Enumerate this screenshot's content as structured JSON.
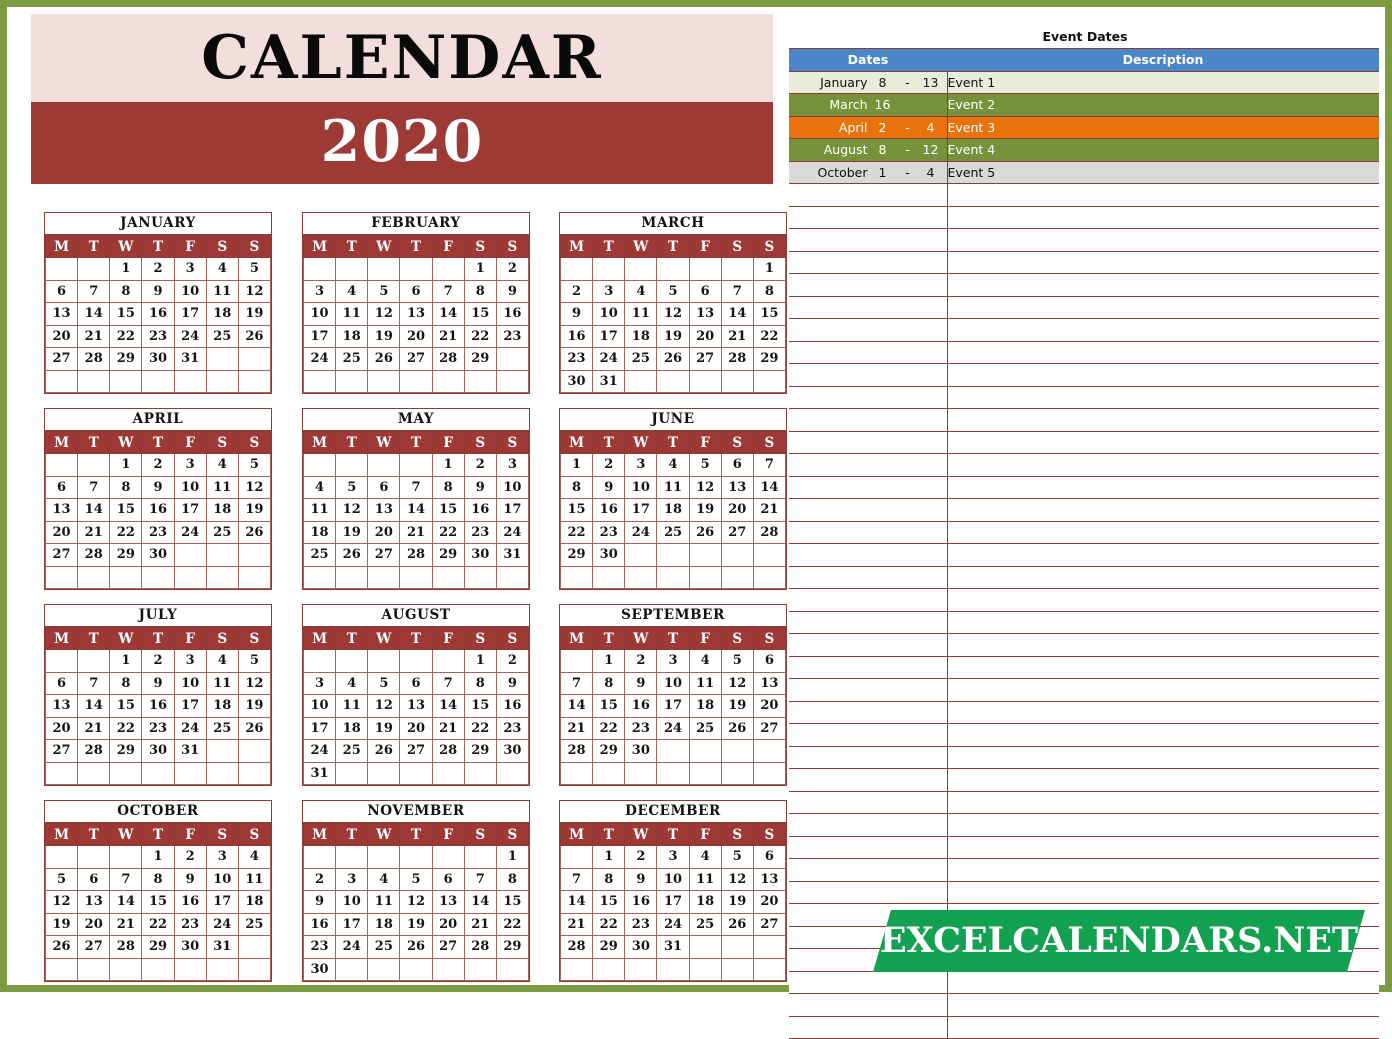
{
  "header": {
    "title": "CALENDAR",
    "year": "2020"
  },
  "branding": {
    "logo_text": "EXCELCALENDARS.NET",
    "logo_color": "#12a150",
    "frame_color": "#7d9b40"
  },
  "theme": {
    "header_bar_color": "#9e3a36",
    "title_bg_color": "#f2dedc",
    "grid_line_color": "#8d3b36",
    "event_header_blue": "#4a86c8",
    "highlight_cream": "#e9ecd9",
    "highlight_green": "#76933c",
    "highlight_orange": "#e8720c",
    "highlight_gray": "#d9d9d9"
  },
  "weekday_headers": [
    "M",
    "T",
    "W",
    "T",
    "F",
    "S",
    "S"
  ],
  "months": [
    {
      "name": "JANUARY",
      "weeks": [
        [
          "",
          "",
          "1",
          "2",
          "3",
          "4",
          "5"
        ],
        [
          "6",
          "7",
          "8",
          "9",
          "10",
          "11",
          "12"
        ],
        [
          "13",
          "14",
          "15",
          "16",
          "17",
          "18",
          "19"
        ],
        [
          "20",
          "21",
          "22",
          "23",
          "24",
          "25",
          "26"
        ],
        [
          "27",
          "28",
          "29",
          "30",
          "31",
          "",
          ""
        ],
        [
          "",
          "",
          "",
          "",
          "",
          "",
          ""
        ]
      ],
      "highlights": [
        {
          "days": [
            "8",
            "9",
            "10",
            "11",
            "12",
            "13"
          ],
          "style": "hl-cream"
        }
      ]
    },
    {
      "name": "FEBRUARY",
      "weeks": [
        [
          "",
          "",
          "",
          "",
          "",
          "1",
          "2"
        ],
        [
          "3",
          "4",
          "5",
          "6",
          "7",
          "8",
          "9"
        ],
        [
          "10",
          "11",
          "12",
          "13",
          "14",
          "15",
          "16"
        ],
        [
          "17",
          "18",
          "19",
          "20",
          "21",
          "22",
          "23"
        ],
        [
          "24",
          "25",
          "26",
          "27",
          "28",
          "29",
          ""
        ],
        [
          "",
          "",
          "",
          "",
          "",
          "",
          ""
        ]
      ],
      "highlights": []
    },
    {
      "name": "MARCH",
      "weeks": [
        [
          "",
          "",
          "",
          "",
          "",
          "",
          "1"
        ],
        [
          "2",
          "3",
          "4",
          "5",
          "6",
          "7",
          "8"
        ],
        [
          "9",
          "10",
          "11",
          "12",
          "13",
          "14",
          "15"
        ],
        [
          "16",
          "17",
          "18",
          "19",
          "20",
          "21",
          "22"
        ],
        [
          "23",
          "24",
          "25",
          "26",
          "27",
          "28",
          "29"
        ],
        [
          "30",
          "31",
          "",
          "",
          "",
          "",
          ""
        ]
      ],
      "highlights": [
        {
          "days": [
            "16"
          ],
          "style": "hl-green"
        }
      ]
    },
    {
      "name": "APRIL",
      "weeks": [
        [
          "",
          "",
          "1",
          "2",
          "3",
          "4",
          "5"
        ],
        [
          "6",
          "7",
          "8",
          "9",
          "10",
          "11",
          "12"
        ],
        [
          "13",
          "14",
          "15",
          "16",
          "17",
          "18",
          "19"
        ],
        [
          "20",
          "21",
          "22",
          "23",
          "24",
          "25",
          "26"
        ],
        [
          "27",
          "28",
          "29",
          "30",
          "",
          "",
          ""
        ],
        [
          "",
          "",
          "",
          "",
          "",
          "",
          ""
        ]
      ],
      "highlights": [
        {
          "days": [
            "2",
            "3",
            "4"
          ],
          "style": "hl-orange"
        }
      ]
    },
    {
      "name": "MAY",
      "weeks": [
        [
          "",
          "",
          "",
          "",
          "1",
          "2",
          "3"
        ],
        [
          "4",
          "5",
          "6",
          "7",
          "8",
          "9",
          "10"
        ],
        [
          "11",
          "12",
          "13",
          "14",
          "15",
          "16",
          "17"
        ],
        [
          "18",
          "19",
          "20",
          "21",
          "22",
          "23",
          "24"
        ],
        [
          "25",
          "26",
          "27",
          "28",
          "29",
          "30",
          "31"
        ],
        [
          "",
          "",
          "",
          "",
          "",
          "",
          ""
        ]
      ],
      "highlights": []
    },
    {
      "name": "JUNE",
      "weeks": [
        [
          "1",
          "2",
          "3",
          "4",
          "5",
          "6",
          "7"
        ],
        [
          "8",
          "9",
          "10",
          "11",
          "12",
          "13",
          "14"
        ],
        [
          "15",
          "16",
          "17",
          "18",
          "19",
          "20",
          "21"
        ],
        [
          "22",
          "23",
          "24",
          "25",
          "26",
          "27",
          "28"
        ],
        [
          "29",
          "30",
          "",
          "",
          "",
          "",
          ""
        ],
        [
          "",
          "",
          "",
          "",
          "",
          "",
          ""
        ]
      ],
      "highlights": []
    },
    {
      "name": "JULY",
      "weeks": [
        [
          "",
          "",
          "1",
          "2",
          "3",
          "4",
          "5"
        ],
        [
          "6",
          "7",
          "8",
          "9",
          "10",
          "11",
          "12"
        ],
        [
          "13",
          "14",
          "15",
          "16",
          "17",
          "18",
          "19"
        ],
        [
          "20",
          "21",
          "22",
          "23",
          "24",
          "25",
          "26"
        ],
        [
          "27",
          "28",
          "29",
          "30",
          "31",
          "",
          ""
        ],
        [
          "",
          "",
          "",
          "",
          "",
          "",
          ""
        ]
      ],
      "highlights": []
    },
    {
      "name": "AUGUST",
      "weeks": [
        [
          "",
          "",
          "",
          "",
          "",
          "1",
          "2"
        ],
        [
          "3",
          "4",
          "5",
          "6",
          "7",
          "8",
          "9"
        ],
        [
          "10",
          "11",
          "12",
          "13",
          "14",
          "15",
          "16"
        ],
        [
          "17",
          "18",
          "19",
          "20",
          "21",
          "22",
          "23"
        ],
        [
          "24",
          "25",
          "26",
          "27",
          "28",
          "29",
          "30"
        ],
        [
          "31",
          "",
          "",
          "",
          "",
          "",
          ""
        ]
      ],
      "highlights": [
        {
          "days": [
            "8",
            "9",
            "10",
            "11",
            "12"
          ],
          "style": "hl-green"
        }
      ]
    },
    {
      "name": "SEPTEMBER",
      "weeks": [
        [
          "",
          "1",
          "2",
          "3",
          "4",
          "5",
          "6"
        ],
        [
          "7",
          "8",
          "9",
          "10",
          "11",
          "12",
          "13"
        ],
        [
          "14",
          "15",
          "16",
          "17",
          "18",
          "19",
          "20"
        ],
        [
          "21",
          "22",
          "23",
          "24",
          "25",
          "26",
          "27"
        ],
        [
          "28",
          "29",
          "30",
          "",
          "",
          "",
          ""
        ],
        [
          "",
          "",
          "",
          "",
          "",
          "",
          ""
        ]
      ],
      "highlights": []
    },
    {
      "name": "OCTOBER",
      "weeks": [
        [
          "",
          "",
          "",
          "1",
          "2",
          "3",
          "4"
        ],
        [
          "5",
          "6",
          "7",
          "8",
          "9",
          "10",
          "11"
        ],
        [
          "12",
          "13",
          "14",
          "15",
          "16",
          "17",
          "18"
        ],
        [
          "19",
          "20",
          "21",
          "22",
          "23",
          "24",
          "25"
        ],
        [
          "26",
          "27",
          "28",
          "29",
          "30",
          "31",
          ""
        ],
        [
          "",
          "",
          "",
          "",
          "",
          "",
          ""
        ]
      ],
      "highlights": [
        {
          "days": [
            "1",
            "2",
            "3",
            "4"
          ],
          "style": "hl-gray"
        }
      ]
    },
    {
      "name": "NOVEMBER",
      "weeks": [
        [
          "",
          "",
          "",
          "",
          "",
          "",
          "1"
        ],
        [
          "2",
          "3",
          "4",
          "5",
          "6",
          "7",
          "8"
        ],
        [
          "9",
          "10",
          "11",
          "12",
          "13",
          "14",
          "15"
        ],
        [
          "16",
          "17",
          "18",
          "19",
          "20",
          "21",
          "22"
        ],
        [
          "23",
          "24",
          "25",
          "26",
          "27",
          "28",
          "29"
        ],
        [
          "30",
          "",
          "",
          "",
          "",
          "",
          ""
        ]
      ],
      "highlights": []
    },
    {
      "name": "DECEMBER",
      "weeks": [
        [
          "",
          "1",
          "2",
          "3",
          "4",
          "5",
          "6"
        ],
        [
          "7",
          "8",
          "9",
          "10",
          "11",
          "12",
          "13"
        ],
        [
          "14",
          "15",
          "16",
          "17",
          "18",
          "19",
          "20"
        ],
        [
          "21",
          "22",
          "23",
          "24",
          "25",
          "26",
          "27"
        ],
        [
          "28",
          "29",
          "30",
          "31",
          "",
          "",
          ""
        ],
        [
          "",
          "",
          "",
          "",
          "",
          "",
          ""
        ]
      ],
      "highlights": []
    }
  ],
  "event_panel": {
    "title": "Event Dates",
    "columns": {
      "dates": "Dates",
      "description": "Description"
    },
    "rows": [
      {
        "month": "January",
        "start": "8",
        "dash": "-",
        "end": "13",
        "description": "Event 1",
        "style": "ev-cream"
      },
      {
        "month": "March",
        "start": "16",
        "dash": "",
        "end": "",
        "description": "Event 2",
        "style": "ev-green"
      },
      {
        "month": "April",
        "start": "2",
        "dash": "-",
        "end": "4",
        "description": "Event 3",
        "style": "ev-orange"
      },
      {
        "month": "August",
        "start": "8",
        "dash": "-",
        "end": "12",
        "description": "Event 4",
        "style": "ev-green"
      },
      {
        "month": "October",
        "start": "1",
        "dash": "-",
        "end": "4",
        "description": "Event 5",
        "style": "ev-gray"
      }
    ],
    "blank_row_count": 38
  }
}
